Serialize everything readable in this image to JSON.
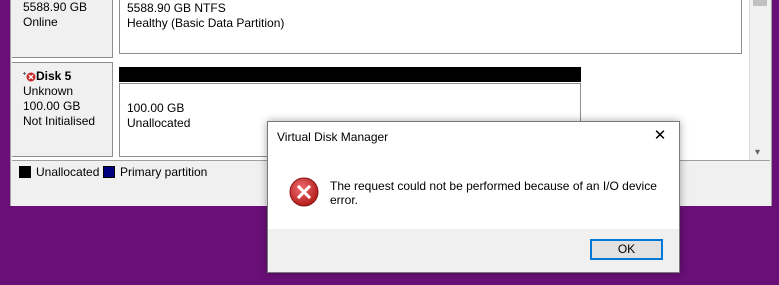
{
  "disks": [
    {
      "id": "prev",
      "size": "5588.90 GB",
      "status": "Online",
      "volume": {
        "line1": "5588.90 GB NTFS",
        "line2": "Healthy (Basic Data Partition)"
      }
    },
    {
      "id": "disk5",
      "name": "Disk 5",
      "type": "Unknown",
      "size": "100.00 GB",
      "status": "Not Initialised",
      "volume": {
        "line1": "100.00 GB",
        "line2": "Unallocated"
      }
    }
  ],
  "legend": {
    "unallocated": "Unallocated",
    "primary": "Primary partition",
    "colors": {
      "unallocated": "#000000",
      "primary": "#00007f"
    }
  },
  "dialog": {
    "title": "Virtual Disk Manager",
    "message": "The request could not be performed because of an I/O device error.",
    "ok_label": "OK",
    "icon": "error-icon"
  },
  "colors": {
    "desktop": "#6a0f78",
    "error": "#c62828"
  }
}
